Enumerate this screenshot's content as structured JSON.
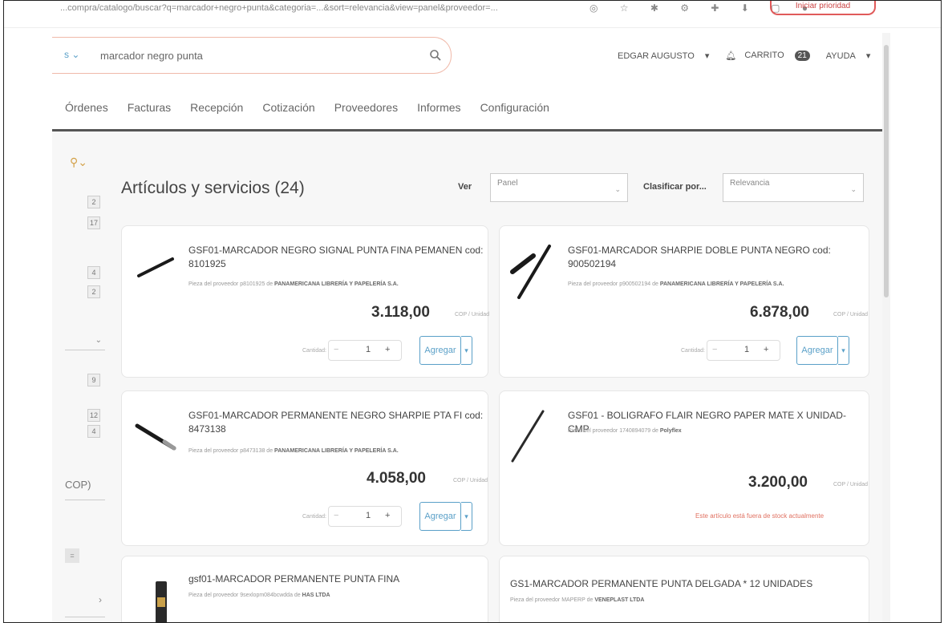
{
  "browser": {
    "url": "...compra/catalogo/buscar?q=marcador+negro+punta&categoria=...&sort=relevancia&view=panel&proveedor=...",
    "cta": "Iniciar prioridad"
  },
  "search": {
    "scope": "s",
    "query": "marcador negro punta"
  },
  "header": {
    "user": "EDGAR AUGUSTO",
    "cart_label": "CARRITO",
    "cart_count": "21",
    "help": "AYUDA"
  },
  "tabs": [
    "Órdenes",
    "Facturas",
    "Recepción",
    "Cotización",
    "Proveedores",
    "Informes",
    "Configuración"
  ],
  "filters": {
    "counts": [
      "2",
      "17",
      "4",
      "2",
      "9",
      "12",
      "4"
    ],
    "currency": "COP)",
    "chip": "="
  },
  "main": {
    "title": "Artículos y servicios (24)",
    "view_label": "Ver",
    "view_value": "Panel",
    "sort_label": "Clasificar por...",
    "sort_value": "Relevancia"
  },
  "cards": [
    {
      "title": "GSF01-MARCADOR NEGRO SIGNAL PUNTA FINA PEMANEN cod: 8101925",
      "supplier_prefix": "Pieza del proveedor p8101925 de",
      "supplier": "PANAMERICANA LIBRERÍA Y PAPELERÍA S.A.",
      "price": "3.118,00",
      "unit": "COP / Unidad",
      "qty_label": "Cantidad:",
      "qty": "1",
      "add": "Agregar"
    },
    {
      "title": "GSF01-MARCADOR SHARPIE DOBLE PUNTA NEGRO cod: 900502194",
      "supplier_prefix": "Pieza del proveedor p900502194 de",
      "supplier": "PANAMERICANA LIBRERÍA Y PAPELERÍA S.A.",
      "price": "6.878,00",
      "unit": "COP / Unidad",
      "qty_label": "Cantidad:",
      "qty": "1",
      "add": "Agregar"
    },
    {
      "title": "GSF01-MARCADOR PERMANENTE NEGRO SHARPIE PTA FI cod: 8473138",
      "supplier_prefix": "Pieza del proveedor p8473138 de",
      "supplier": "PANAMERICANA LIBRERÍA Y PAPELERÍA S.A.",
      "price": "4.058,00",
      "unit": "COP / Unidad",
      "qty_label": "Cantidad:",
      "qty": "1",
      "add": "Agregar"
    },
    {
      "title": "GSF01 - BOLIGRAFO FLAIR NEGRO PAPER MATE X UNIDAD-CMP",
      "supplier_prefix": "Pieza del proveedor 1740894079 de",
      "supplier": "Polyflex",
      "price": "3.200,00",
      "unit": "COP / Unidad",
      "stock": "Este artículo está fuera de stock actualmente"
    },
    {
      "title": "gsf01-MARCADOR PERMANENTE PUNTA FINA",
      "supplier_prefix": "Pieza del proveedor 9sexlopm084bcwdda de",
      "supplier": "HAS LTDA"
    },
    {
      "title": "GS1-MARCADOR PERMANENTE PUNTA DELGADA * 12 UNIDADES",
      "supplier_prefix": "Pieza del proveedor MAPERP de",
      "supplier": "VENEPLAST LTDA"
    }
  ]
}
